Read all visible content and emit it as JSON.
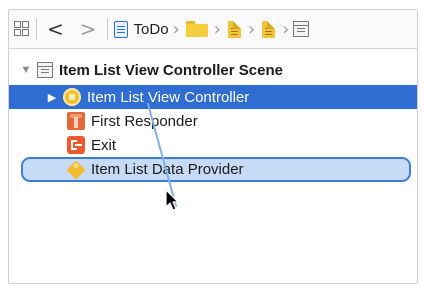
{
  "jumpbar": {
    "project_label": "ToDo"
  },
  "outline": {
    "scene_title": "Item List View Controller Scene",
    "items": [
      {
        "label": "Item List View Controller",
        "icon": "view-controller-icon",
        "selected": true,
        "disclosure": "collapsed"
      },
      {
        "label": "First Responder",
        "icon": "first-responder-icon"
      },
      {
        "label": "Exit",
        "icon": "exit-icon"
      },
      {
        "label": "Item List Data Provider",
        "icon": "object-cube-icon",
        "drop_target": true
      }
    ]
  },
  "colors": {
    "selection": "#2f6dd3",
    "drop_target_fill": "#c7daf6",
    "drop_target_border": "#3b7cdb",
    "connection_line": "#7fb1ea"
  }
}
